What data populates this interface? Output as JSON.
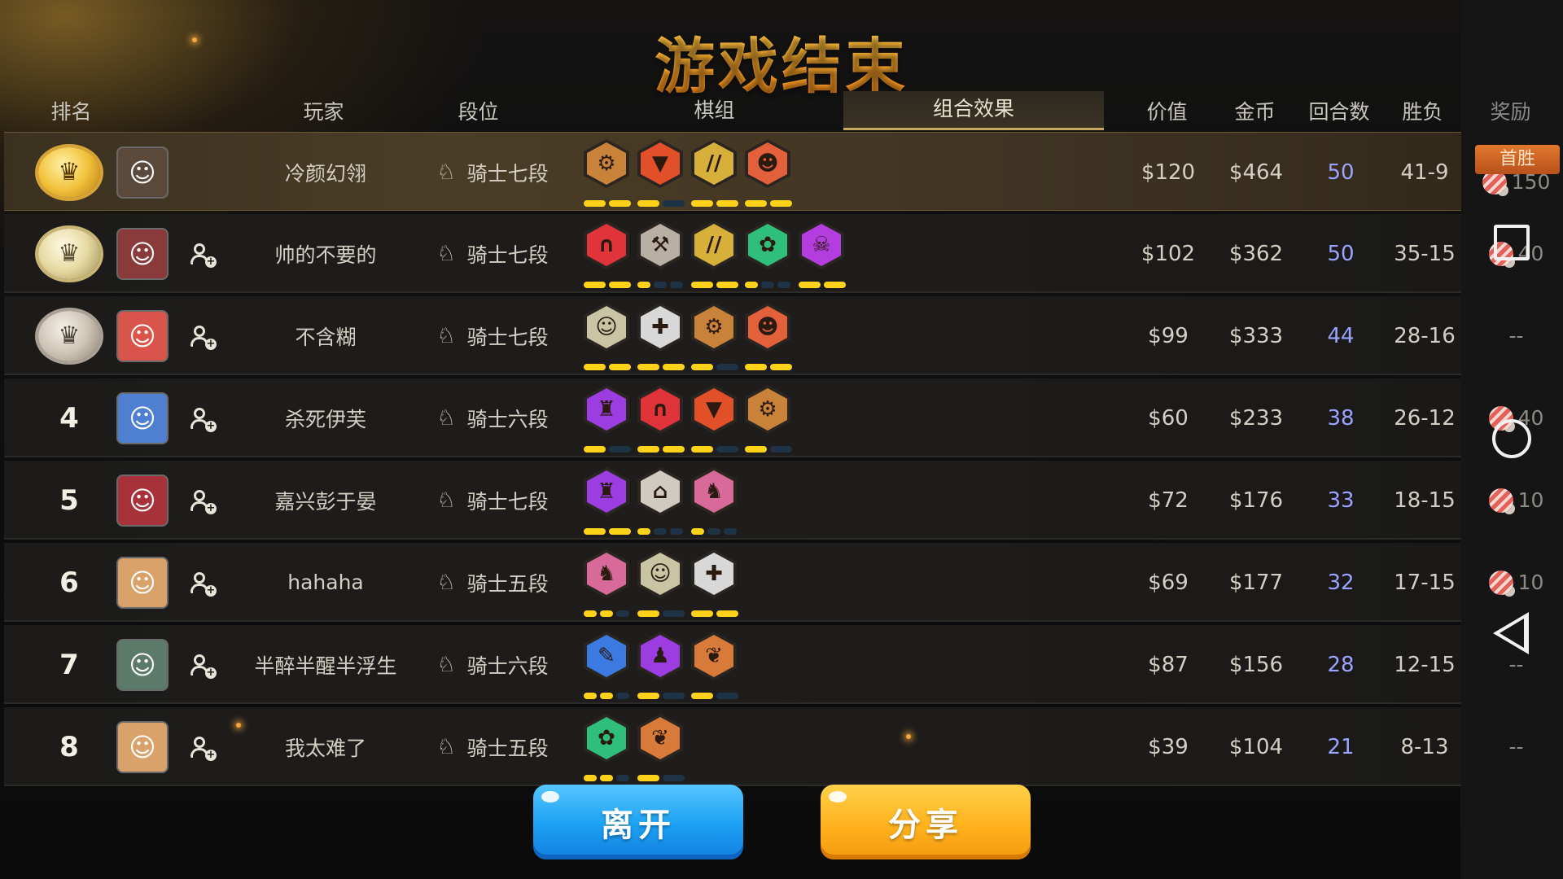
{
  "title": "游戏结束",
  "headers": {
    "rank": "排名",
    "player": "玩家",
    "tier": "段位",
    "pieces": "棋组",
    "synergy": "组合效果",
    "value": "价值",
    "gold": "金币",
    "rounds": "回合数",
    "record": "胜负",
    "reward": "奖励"
  },
  "first_win_label": "首胜",
  "rows": [
    {
      "rank": "",
      "medal": "gold",
      "avatar_icon": "warrior-avatar-icon",
      "avatar_color": "#5b4a3c",
      "friend": false,
      "name": "冷颜幻翎",
      "tier": "骑士七段",
      "value": "$120",
      "gold": "$464",
      "rounds": "50",
      "record": "41-9",
      "reward": "150",
      "synergies": [
        {
          "icon": "gear-icon",
          "color": "#c9823a",
          "glyph": "⚙"
        },
        {
          "icon": "goblin-mask-icon",
          "color": "#e2502a",
          "glyph": "▼"
        },
        {
          "icon": "claw-icon",
          "color": "#d6b03a",
          "glyph": "//"
        },
        {
          "icon": "orc-icon",
          "color": "#e2603a",
          "glyph": "☻"
        }
      ],
      "bars": [
        [
          1,
          1
        ],
        [
          1,
          0
        ],
        [
          1,
          1
        ],
        [
          1,
          1
        ]
      ]
    },
    {
      "rank": "",
      "medal": "silver",
      "avatar_icon": "knight-avatar-icon",
      "avatar_color": "#8a3a3a",
      "friend": true,
      "name": "帅的不要的",
      "tier": "骑士七段",
      "value": "$102",
      "gold": "$362",
      "rounds": "50",
      "record": "35-15",
      "reward": "40",
      "synergies": [
        {
          "icon": "arch-icon",
          "color": "#e0343a",
          "glyph": "∩"
        },
        {
          "icon": "axe-icon",
          "color": "#b8b0a4",
          "glyph": "⚒"
        },
        {
          "icon": "claw-icon",
          "color": "#d6b03a",
          "glyph": "//"
        },
        {
          "icon": "paw-icon",
          "color": "#2fbf7a",
          "glyph": "✿"
        },
        {
          "icon": "demon-icon",
          "color": "#b43de0",
          "glyph": "☠"
        }
      ],
      "bars": [
        [
          1,
          1
        ],
        [
          1,
          0,
          0
        ],
        [
          1,
          1
        ],
        [
          1,
          0,
          0
        ],
        [
          1,
          1
        ]
      ]
    },
    {
      "rank": "",
      "medal": "bronze",
      "avatar_icon": "dragon-avatar-icon",
      "avatar_color": "#d9544a",
      "friend": true,
      "name": "不含糊",
      "tier": "骑士七段",
      "value": "$99",
      "gold": "$333",
      "rounds": "44",
      "record": "28-16",
      "reward": "--",
      "synergies": [
        {
          "icon": "beast-icon",
          "color": "#c9c4a4",
          "glyph": "☺"
        },
        {
          "icon": "cross-icon",
          "color": "#d8d8d8",
          "glyph": "✚"
        },
        {
          "icon": "gear-icon",
          "color": "#c9823a",
          "glyph": "⚙"
        },
        {
          "icon": "orc-icon",
          "color": "#e2603a",
          "glyph": "☻"
        }
      ],
      "bars": [
        [
          1,
          1
        ],
        [
          1,
          1
        ],
        [
          1,
          0
        ],
        [
          1,
          1
        ]
      ]
    },
    {
      "rank": "4",
      "medal": "",
      "avatar_icon": "blue-beast-avatar-icon",
      "avatar_color": "#4f7fd0",
      "friend": true,
      "name": "杀死伊芙",
      "tier": "骑士六段",
      "value": "$60",
      "gold": "$233",
      "rounds": "38",
      "record": "26-12",
      "reward": "40",
      "synergies": [
        {
          "icon": "mage-icon",
          "color": "#9b3de0",
          "glyph": "♜"
        },
        {
          "icon": "arch-icon",
          "color": "#e0343a",
          "glyph": "∩"
        },
        {
          "icon": "goblin-mask-icon",
          "color": "#e2502a",
          "glyph": "▼"
        },
        {
          "icon": "gear-icon",
          "color": "#c9823a",
          "glyph": "⚙"
        }
      ],
      "bars": [
        [
          1,
          0
        ],
        [
          1,
          1
        ],
        [
          1,
          0
        ],
        [
          1,
          0
        ]
      ]
    },
    {
      "rank": "5",
      "medal": "",
      "avatar_icon": "red-ogre-avatar-icon",
      "avatar_color": "#a8323a",
      "friend": true,
      "name": "嘉兴彭于晏",
      "tier": "骑士七段",
      "value": "$72",
      "gold": "$176",
      "rounds": "33",
      "record": "18-15",
      "reward": "10",
      "synergies": [
        {
          "icon": "mage-icon",
          "color": "#9b3de0",
          "glyph": "♜"
        },
        {
          "icon": "helmet-icon",
          "color": "#d0cac0",
          "glyph": "⌂"
        },
        {
          "icon": "knight-piece-icon",
          "color": "#d86a9a",
          "glyph": "♞"
        }
      ],
      "bars": [
        [
          1,
          1
        ],
        [
          1,
          0,
          0
        ],
        [
          1,
          0,
          0
        ]
      ]
    },
    {
      "rank": "6",
      "medal": "",
      "avatar_icon": "elf-avatar-icon",
      "avatar_color": "#d9a26a",
      "friend": true,
      "name": "hahaha",
      "tier": "骑士五段",
      "value": "$69",
      "gold": "$177",
      "rounds": "32",
      "record": "17-15",
      "reward": "10",
      "synergies": [
        {
          "icon": "knight-piece-icon",
          "color": "#d86a9a",
          "glyph": "♞"
        },
        {
          "icon": "beast-icon",
          "color": "#c9c4a4",
          "glyph": "☺"
        },
        {
          "icon": "cross-icon",
          "color": "#d8d8d8",
          "glyph": "✚"
        }
      ],
      "bars": [
        [
          1,
          1,
          0
        ],
        [
          1,
          0
        ],
        [
          1,
          1
        ]
      ]
    },
    {
      "rank": "7",
      "medal": "",
      "avatar_icon": "robot-avatar-icon",
      "avatar_color": "#5c7a6a",
      "friend": true,
      "name": "半醉半醒半浮生",
      "tier": "骑士六段",
      "value": "$87",
      "gold": "$156",
      "rounds": "28",
      "record": "12-15",
      "reward": "--",
      "synergies": [
        {
          "icon": "feather-icon",
          "color": "#3b7ae0",
          "glyph": "✎"
        },
        {
          "icon": "shadow-mage-icon",
          "color": "#9b3de0",
          "glyph": "♟"
        },
        {
          "icon": "leaf-icon",
          "color": "#d87a3a",
          "glyph": "❦"
        }
      ],
      "bars": [
        [
          1,
          1,
          0
        ],
        [
          1,
          0
        ],
        [
          1,
          0
        ]
      ]
    },
    {
      "rank": "8",
      "medal": "",
      "avatar_icon": "elf-avatar-icon",
      "avatar_color": "#d9a26a",
      "friend": true,
      "name": "我太难了",
      "tier": "骑士五段",
      "value": "$39",
      "gold": "$104",
      "rounds": "21",
      "record": "8-13",
      "reward": "--",
      "synergies": [
        {
          "icon": "paw-icon",
          "color": "#2fbf7a",
          "glyph": "✿"
        },
        {
          "icon": "leaf-icon",
          "color": "#d87a3a",
          "glyph": "❦"
        }
      ],
      "bars": [
        [
          1,
          1,
          0
        ],
        [
          1,
          0
        ]
      ]
    }
  ],
  "buttons": {
    "leave": "离开",
    "share": "分享"
  },
  "colors": {
    "accent_gold": "#ffb21c",
    "leave_blue": "#1aa0f2",
    "rounds_blue": "#9aa3ff",
    "bar_on": "#ffd21a"
  }
}
